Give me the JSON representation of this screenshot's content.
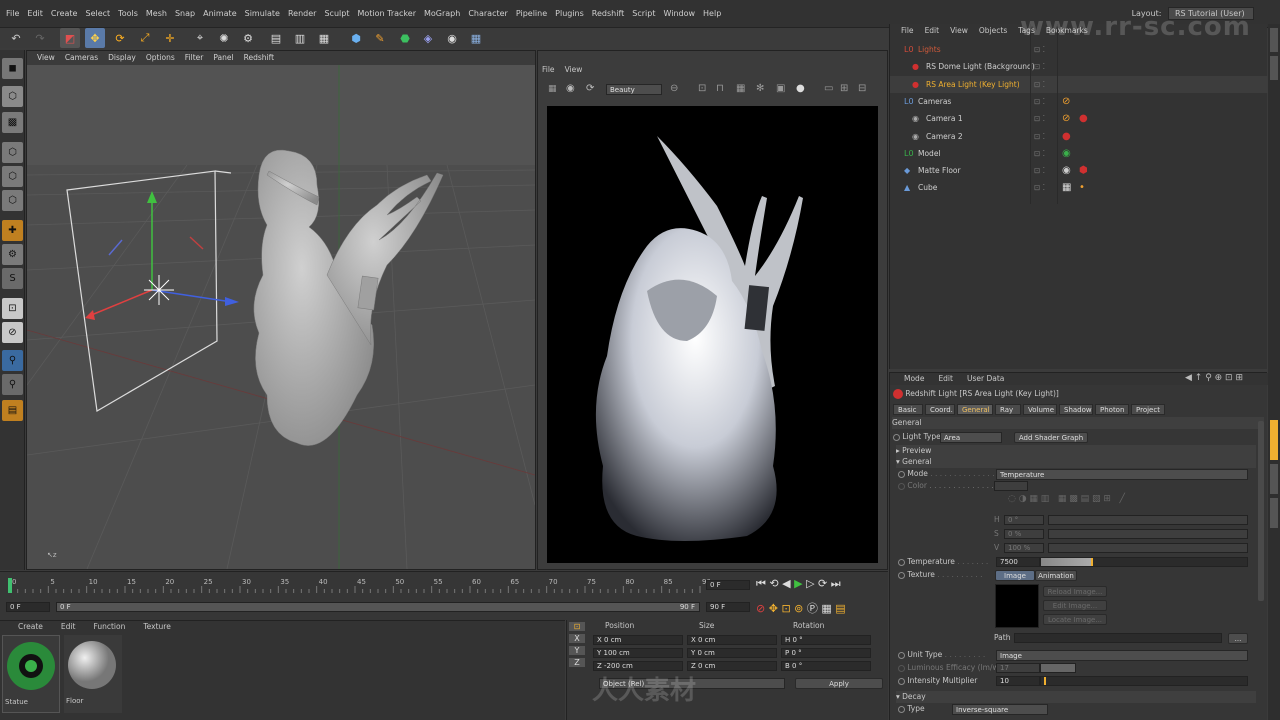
{
  "menu": [
    "File",
    "Edit",
    "Create",
    "Select",
    "Tools",
    "Mesh",
    "Snap",
    "Animate",
    "Simulate",
    "Render",
    "Sculpt",
    "Motion Tracker",
    "MoGraph",
    "Character",
    "Pipeline",
    "Plugins",
    "Redshift",
    "Script",
    "Window",
    "Help"
  ],
  "layout": {
    "label": "Layout:",
    "value": "RS Tutorial (User)"
  },
  "viewport": {
    "menu": [
      "View",
      "Cameras",
      "Display",
      "Options",
      "Filter",
      "Panel",
      "Redshift"
    ]
  },
  "render_view": {
    "menu": [
      "File",
      "View"
    ],
    "channel": "Beauty"
  },
  "object_manager": {
    "menu": [
      "File",
      "Edit",
      "View",
      "Objects",
      "Tags",
      "Bookmarks"
    ],
    "objects": [
      {
        "name": "Lights",
        "color": "#d05a3a"
      },
      {
        "name": "RS Dome Light (Background)",
        "color": "#d0d0d0"
      },
      {
        "name": "RS Area Light (Key Light)",
        "color": "#f0b030"
      },
      {
        "name": "Cameras",
        "color": "#d0d0d0"
      },
      {
        "name": "Camera 1",
        "color": "#d0d0d0"
      },
      {
        "name": "Camera 2",
        "color": "#d0d0d0"
      },
      {
        "name": "Model",
        "color": "#d0d0d0"
      },
      {
        "name": "Matte Floor",
        "color": "#d0d0d0"
      },
      {
        "name": "Cube",
        "color": "#d0d0d0"
      }
    ]
  },
  "attributes": {
    "menu": [
      "Mode",
      "Edit",
      "User Data"
    ],
    "title": "Redshift Light [RS Area Light (Key Light)]",
    "tabs": [
      "Basic",
      "Coord.",
      "General",
      "Ray",
      "Volume",
      "Shadow",
      "Photon",
      "Project"
    ],
    "section_general": "General",
    "light_type_label": "Light Type",
    "light_type_value": "Area",
    "add_shader_graph": "Add Shader Graph",
    "preview": "Preview",
    "general_group": "General",
    "mode_label": "Mode",
    "mode_value": "Temperature",
    "color_label": "Color",
    "h_label": "H",
    "h_value": "0 °",
    "s_label": "S",
    "s_value": "0 %",
    "v_label": "V",
    "v_value": "100 %",
    "temperature_label": "Temperature",
    "temperature_value": "7500",
    "temperature_fill": 0.05,
    "texture_label": "Texture",
    "texture_tabs": [
      "Image",
      "Animation"
    ],
    "reload_image": "Reload Image...",
    "edit_image": "Edit Image...",
    "locate_image": "Locate Image...",
    "path_label": "Path",
    "path_btn": "...",
    "unit_type_label": "Unit Type",
    "unit_type_value": "Image",
    "luminous_label": "Luminous Efficacy (lm/w)",
    "luminous_value": "17",
    "intensity_label": "Intensity Multiplier",
    "intensity_value": "10",
    "decay": "Decay",
    "type_label": "Type",
    "type_value": "Inverse-square"
  },
  "timeline": {
    "ticks": [
      "0",
      "5",
      "10",
      "15",
      "20",
      "25",
      "30",
      "35",
      "40",
      "45",
      "50",
      "55",
      "60",
      "65",
      "70",
      "75",
      "80",
      "85",
      "90"
    ],
    "current_frame": "0 F",
    "start": "0 F",
    "range_start": "0 F",
    "range_end": "90 F",
    "end": "90 F"
  },
  "material_manager": {
    "menu": [
      "Create",
      "Edit",
      "Function",
      "Texture"
    ],
    "materials": [
      {
        "name": "Statue"
      },
      {
        "name": "Floor"
      }
    ]
  },
  "coordinates": {
    "headers": [
      "Position",
      "Size",
      "Rotation"
    ],
    "rows": [
      {
        "p_label": "X",
        "p": "0 cm",
        "s_label": "X",
        "s": "0 cm",
        "r_label": "H",
        "r": "0 °"
      },
      {
        "p_label": "Y",
        "p": "100 cm",
        "s_label": "Y",
        "s": "0 cm",
        "r_label": "P",
        "r": "0 °"
      },
      {
        "p_label": "Z",
        "p": "-200 cm",
        "s_label": "Z",
        "s": "0 cm",
        "r_label": "B",
        "r": "0 °"
      }
    ],
    "mode": "Object (Rel)",
    "size_mode": "Size",
    "apply": "Apply"
  },
  "watermark": {
    "top": "www.rr-sc.com",
    "bottom": "人人素材"
  },
  "colors": {
    "accent": "#f0b030",
    "selected_tab": "#5c5c5c"
  }
}
